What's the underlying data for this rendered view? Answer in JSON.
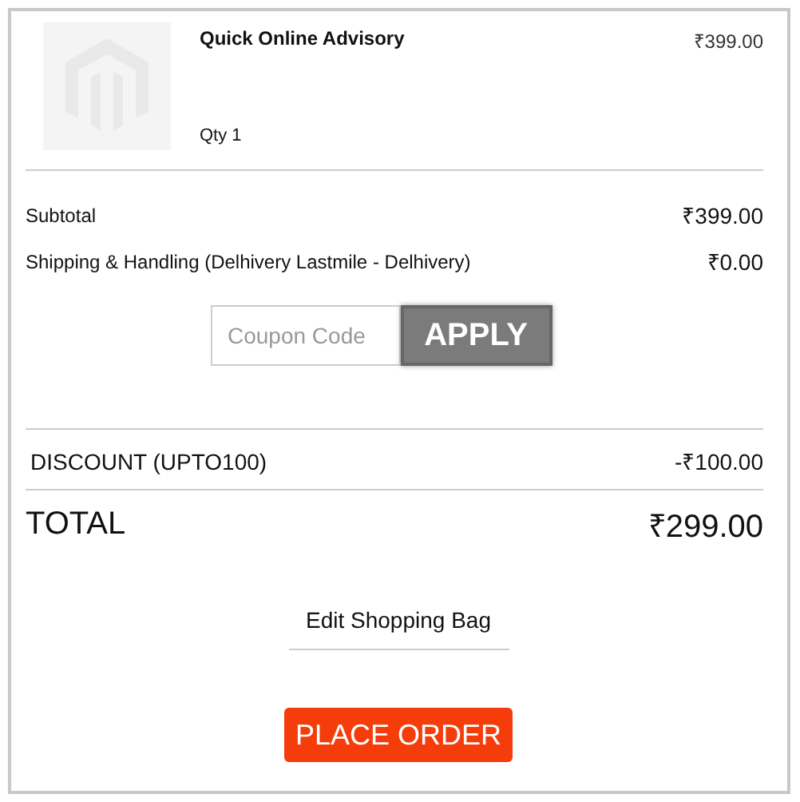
{
  "item": {
    "name": "Quick Online Advisory",
    "price": "₹399.00",
    "qty": "Qty 1"
  },
  "totals": [
    {
      "label": "Subtotal",
      "value": "₹399.00"
    },
    {
      "label": "Shipping & Handling (Delhivery Lastmile - Delhivery)",
      "value": "₹0.00"
    }
  ],
  "coupon": {
    "placeholder": "Coupon Code",
    "button": "APPLY"
  },
  "discount": {
    "label": "DISCOUNT (UPTO100)",
    "value": "-₹100.00"
  },
  "total": {
    "label": "TOTAL",
    "value": "₹299.00"
  },
  "edit_link": "Edit Shopping Bag",
  "place_order": "PLACE ORDER"
}
